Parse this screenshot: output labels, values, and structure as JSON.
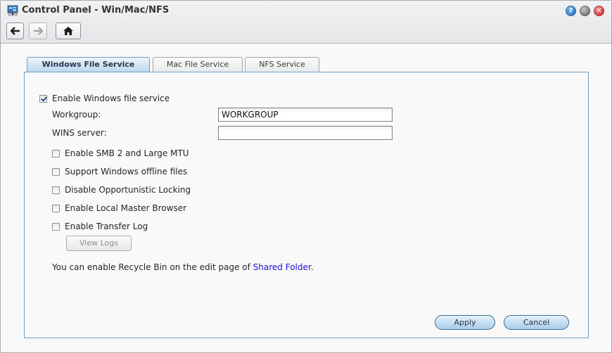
{
  "window": {
    "title": "Control Panel - Win/Mac/NFS",
    "app_icon": "control-panel-icon",
    "controls": {
      "help": "?",
      "minimize": "",
      "close": "✕"
    }
  },
  "nav": {
    "back_icon": "arrow-left-icon",
    "forward_icon": "arrow-right-icon",
    "home_icon": "home-icon"
  },
  "tabs": [
    {
      "label": "Windows File Service",
      "active": true
    },
    {
      "label": "Mac File Service",
      "active": false
    },
    {
      "label": "NFS Service",
      "active": false
    }
  ],
  "form": {
    "enable_service": {
      "label": "Enable Windows file service",
      "checked": true
    },
    "workgroup": {
      "label": "Workgroup:",
      "value": "WORKGROUP"
    },
    "wins_server": {
      "label": "WINS server:",
      "value": ""
    },
    "options": [
      {
        "label": "Enable SMB 2 and Large MTU",
        "checked": false
      },
      {
        "label": "Support Windows offline files",
        "checked": false
      },
      {
        "label": "Disable Opportunistic Locking",
        "checked": false
      },
      {
        "label": "Enable Local Master Browser",
        "checked": false
      },
      {
        "label": "Enable Transfer Log",
        "checked": false
      }
    ],
    "view_logs_label": "View Logs",
    "note_prefix": "You can enable Recycle Bin on the edit page of ",
    "note_link": "Shared Folder",
    "note_suffix": "."
  },
  "footer": {
    "apply_label": "Apply",
    "cancel_label": "Cancel"
  },
  "colors": {
    "accent": "#6f9ebe",
    "link": "#1c12d6",
    "close": "#c41a1a",
    "help": "#1a62b8"
  }
}
